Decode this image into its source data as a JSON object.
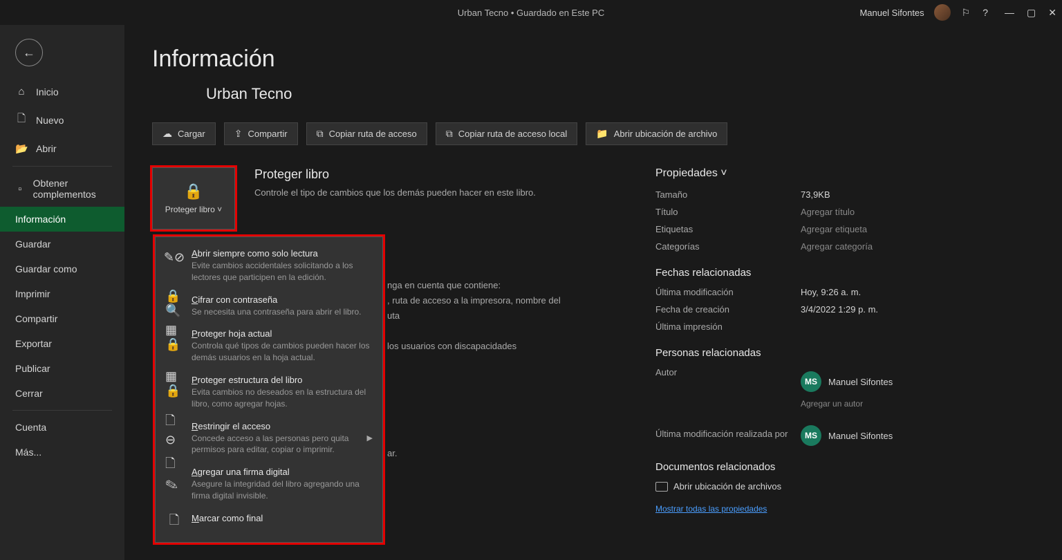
{
  "titlebar": {
    "center": "Urban Tecno  •  Guardado en Este PC",
    "user": "Manuel Sifontes"
  },
  "sidebar": {
    "items": [
      {
        "icon": "⌂",
        "label": "Inicio"
      },
      {
        "icon": "🗋",
        "label": "Nuevo"
      },
      {
        "icon": "📂",
        "label": "Abrir"
      },
      {
        "icon": "▫",
        "label": "Obtener complementos"
      },
      {
        "icon": "",
        "label": "Información",
        "active": true
      },
      {
        "icon": "",
        "label": "Guardar"
      },
      {
        "icon": "",
        "label": "Guardar como"
      },
      {
        "icon": "",
        "label": "Imprimir"
      },
      {
        "icon": "",
        "label": "Compartir"
      },
      {
        "icon": "",
        "label": "Exportar"
      },
      {
        "icon": "",
        "label": "Publicar"
      },
      {
        "icon": "",
        "label": "Cerrar"
      },
      {
        "icon": "",
        "label": "Cuenta"
      },
      {
        "icon": "",
        "label": "Más..."
      }
    ]
  },
  "main": {
    "page_title": "Información",
    "doc_title": "Urban Tecno",
    "actions": [
      {
        "icon": "☁",
        "label": "Cargar"
      },
      {
        "icon": "⇪",
        "label": "Compartir"
      },
      {
        "icon": "⧉",
        "label": "Copiar ruta de acceso"
      },
      {
        "icon": "⧉",
        "label": "Copiar ruta de acceso local"
      },
      {
        "icon": "📁",
        "label": "Abrir ubicación de archivo"
      }
    ],
    "protect_tile": {
      "label": "Proteger libro ˅"
    },
    "protect_section": {
      "title": "Proteger libro",
      "desc": "Controle el tipo de cambios que los demás pueden hacer en este libro."
    },
    "peek_lines": [
      "nga en cuenta que contiene:",
      ", ruta de acceso a la impresora, nombre del",
      "uta",
      "",
      "los usuarios con discapacidades",
      "",
      "",
      "",
      "",
      "",
      "",
      "ar."
    ],
    "dropdown": [
      {
        "icon": "✎⊘",
        "title": "Abrir siempre como solo lectura",
        "desc": "Evite cambios accidentales solicitando a los lectores que participen en la edición."
      },
      {
        "icon": "🔒🔍",
        "title": "Cifrar con contraseña",
        "desc": "Se necesita una contraseña para abrir el libro."
      },
      {
        "icon": "▦🔒",
        "title": "Proteger hoja actual",
        "desc": "Controla qué tipos de cambios pueden hacer los demás usuarios en la hoja actual."
      },
      {
        "icon": "▦🔒",
        "title": "Proteger estructura del libro",
        "desc": "Evita cambios no deseados en la estructura del libro, como agregar hojas."
      },
      {
        "icon": "🗋⊖",
        "title": "Restringir el acceso",
        "desc": "Concede acceso a las personas pero quita permisos para editar, copiar o imprimir.",
        "arrow": true
      },
      {
        "icon": "🗋✎",
        "title": "Agregar una firma digital",
        "desc": "Asegure la integridad del libro agregando una firma digital invisible."
      },
      {
        "icon": "🗋",
        "title": "Marcar como final",
        "desc": ""
      }
    ]
  },
  "props": {
    "header": "Propiedades ˅",
    "basic": [
      {
        "label": "Tamaño",
        "value": "73,9KB"
      },
      {
        "label": "Título",
        "value": "Agregar título",
        "placeholder": true
      },
      {
        "label": "Etiquetas",
        "value": "Agregar etiqueta",
        "placeholder": true
      },
      {
        "label": "Categorías",
        "value": "Agregar categoría",
        "placeholder": true
      }
    ],
    "dates_header": "Fechas relacionadas",
    "dates": [
      {
        "label": "Última modificación",
        "value": "Hoy, 9:26 a. m."
      },
      {
        "label": "Fecha de creación",
        "value": "3/4/2022 1:29 p. m."
      },
      {
        "label": "Última impresión",
        "value": ""
      }
    ],
    "people_header": "Personas relacionadas",
    "author_label": "Autor",
    "author_name": "Manuel Sifontes",
    "author_initials": "MS",
    "add_author": "Agregar un autor",
    "lastmod_label": "Última modificación realizada por",
    "lastmod_name": "Manuel Sifontes",
    "docs_header": "Documentos relacionados",
    "open_location": "Abrir ubicación de archivos",
    "show_all": "Mostrar todas las propiedades"
  }
}
